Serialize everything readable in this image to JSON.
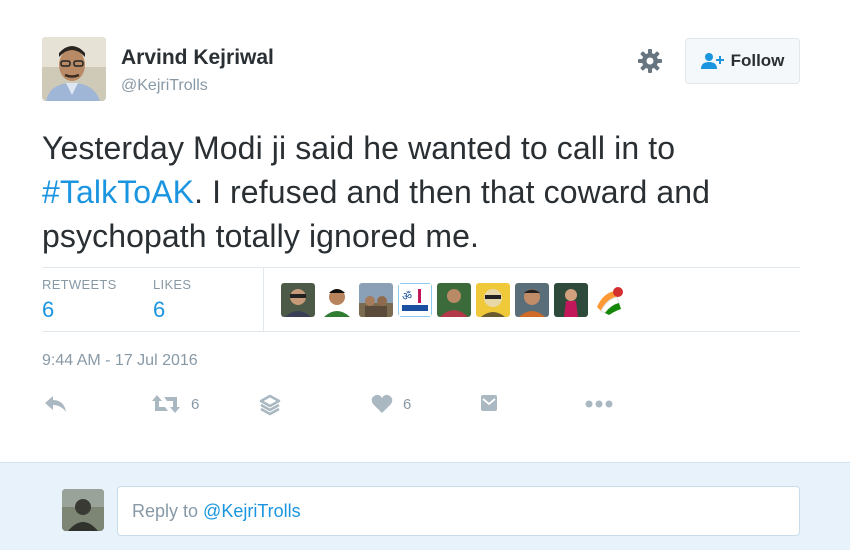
{
  "author": {
    "name": "Arvind Kejriwal",
    "handle": "@KejriTrolls"
  },
  "follow_button": {
    "label": "Follow"
  },
  "tweet": {
    "text_before": "Yesterday Modi ji said he wanted to call in to ",
    "hashtag": "#TalkToAK",
    "text_after": ". I refused and then that coward and psychopath totally ignored me."
  },
  "stats": {
    "retweets_label": "RETWEETS",
    "retweets_value": "6",
    "likes_label": "LIKES",
    "likes_value": "6"
  },
  "timestamp": "9:44 AM - 17 Jul 2016",
  "actions": {
    "retweet_count": "6",
    "like_count": "6"
  },
  "reply": {
    "prefix": "Reply to ",
    "handle": "@KejriTrolls"
  },
  "colors": {
    "accent": "#1b95e0",
    "muted": "#8899a6",
    "text": "#292f33",
    "reply_bg": "#e8f2fa"
  },
  "icons": [
    "gear-icon",
    "follow-person-icon",
    "reply-icon",
    "retweet-icon",
    "stack-icon",
    "heart-icon",
    "message-icon",
    "more-icon"
  ]
}
